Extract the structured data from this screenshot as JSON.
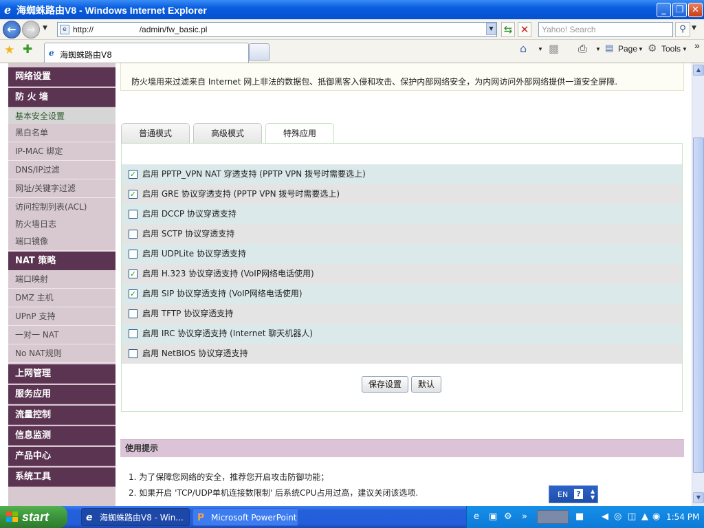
{
  "window": {
    "title": "海蜘蛛路由V8 - Windows Internet Explorer",
    "ie_glyph": "e",
    "min": "_",
    "max": "❐",
    "close": "✕"
  },
  "toolbar": {
    "url": "http://                    /admin/fw_basic.pl",
    "search_placeholder": "Yahoo! Search",
    "tab_title": "海蜘蛛路由V8",
    "page_label": "Page",
    "tools_label": "Tools",
    "overflow": "»"
  },
  "sidebar": {
    "sections": [
      {
        "label": "网络设置"
      },
      {
        "label": "防 火 墙"
      },
      {
        "label": "NAT 策略"
      },
      {
        "label": "上网管理"
      },
      {
        "label": "服务应用"
      },
      {
        "label": "流量控制"
      },
      {
        "label": "信息监测"
      },
      {
        "label": "产品中心"
      },
      {
        "label": "系统工具"
      }
    ],
    "firewall_items": [
      {
        "label": "基本安全设置",
        "selected": true
      },
      {
        "label": "黑白名单"
      },
      {
        "label": "IP-MAC 绑定"
      },
      {
        "label": "DNS/IP过滤"
      },
      {
        "label": "网址/关键字过滤"
      },
      {
        "label": "访问控制列表(ACL)"
      },
      {
        "label": "防火墙日志"
      },
      {
        "label": "端口镜像"
      }
    ],
    "nat_items": [
      {
        "label": "端口映射"
      },
      {
        "label": "DMZ 主机"
      },
      {
        "label": "UPnP 支持"
      },
      {
        "label": "一对一 NAT"
      },
      {
        "label": "No NAT规则"
      }
    ]
  },
  "main": {
    "description": "防火墙用来过滤来自 Internet 网上非法的数据包、抵御黑客入侵和攻击、保护内部网络安全，为内网访问外部网络提供一道安全屏障.",
    "tabs": [
      {
        "label": "普通模式"
      },
      {
        "label": "高级模式"
      },
      {
        "label": "特殊应用",
        "active": true
      }
    ],
    "options": [
      {
        "label": "启用  PPTP_VPN NAT 穿透支持 (PPTP VPN 拨号时需要选上)",
        "checked": true
      },
      {
        "label": "启用  GRE 协议穿透支持 (PPTP VPN 拨号时需要选上)",
        "checked": true
      },
      {
        "label": "启用  DCCP 协议穿透支持",
        "checked": false
      },
      {
        "label": "启用  SCTP 协议穿透支持",
        "checked": false
      },
      {
        "label": "启用  UDPLite 协议穿透支持",
        "checked": false
      },
      {
        "label": "启用  H.323 协议穿透支持 (VoIP网络电话使用)",
        "checked": true
      },
      {
        "label": "启用  SIP 协议穿透支持 (VoIP网络电话使用)",
        "checked": true
      },
      {
        "label": "启用  TFTP 协议穿透支持",
        "checked": false
      },
      {
        "label": "启用  IRC 协议穿透支持 (Internet 聊天机器人)",
        "checked": false
      },
      {
        "label": "启用  NetBIOS 协议穿透支持",
        "checked": false
      }
    ],
    "save_label": "保存设置",
    "default_label": "默认",
    "tips_title": "使用提示",
    "tips": [
      "1.   为了保障您网络的安全，推荐您开启攻击防御功能；",
      "2.   如果开启 'TCP/UDP单机连接数限制' 后系统CPU占用过高，建议关闭该选项."
    ]
  },
  "langbar": {
    "lang": "EN",
    "help": "?"
  },
  "taskbar": {
    "start_label": "start",
    "tasks": [
      {
        "label": "海蜘蛛路由V8 - Win...",
        "icon": "e",
        "active": true
      },
      {
        "label": "Microsoft PowerPoint ...",
        "icon": "P",
        "active": false
      }
    ],
    "clock": "1:54 PM"
  }
}
